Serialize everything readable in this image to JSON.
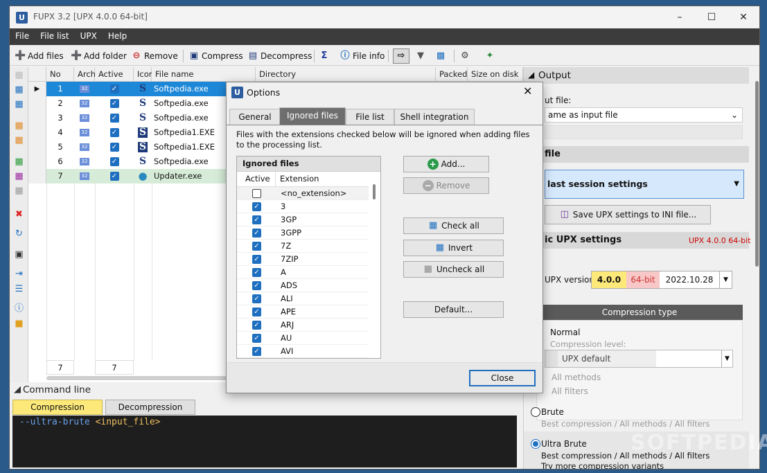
{
  "window": {
    "title": "FUPX 3.2   [UPX 4.0.0 64-bit]",
    "app_icon": "U"
  },
  "menu": [
    "File",
    "File list",
    "UPX",
    "Help"
  ],
  "toolbar": {
    "add_files": "Add files",
    "add_folder": "Add folder",
    "remove": "Remove",
    "compress": "Compress",
    "decompress": "Decompress",
    "file_info": "File info"
  },
  "grid": {
    "columns": [
      "No",
      "Arch.",
      "Active",
      "Icon",
      "File name",
      "Directory",
      "Packed",
      "Size on disk"
    ],
    "rows": [
      {
        "no": "1",
        "arch": "32",
        "name": "Softpedia.exe",
        "icon": "s"
      },
      {
        "no": "2",
        "arch": "32",
        "name": "Softpedia.exe",
        "icon": "s"
      },
      {
        "no": "3",
        "arch": "32",
        "name": "Softpedia.exe",
        "icon": "s"
      },
      {
        "no": "4",
        "arch": "32",
        "name": "Softpedia1.EXE",
        "icon": "box"
      },
      {
        "no": "5",
        "arch": "32",
        "name": "Softpedia1.EXE",
        "icon": "box"
      },
      {
        "no": "6",
        "arch": "32",
        "name": "Softpedia.exe",
        "icon": "s"
      },
      {
        "no": "7",
        "arch": "32",
        "name": "Updater.exe",
        "icon": "globe"
      }
    ],
    "footer_count": "7",
    "footer_active": "7"
  },
  "command_line": {
    "title": "Command line",
    "tab_compression": "Compression",
    "tab_decompression": "Decompression",
    "arg_prefix": "--",
    "arg": "ultra-brute",
    "input_token": "<input_file>"
  },
  "output": {
    "title": "Output",
    "output_file_label": "ut file:",
    "output_file_value": "ame as input file",
    "file_section": "file",
    "session_value": "last  session  settings",
    "save_ini": "Save UPX settings to INI file...",
    "upx_settings": "ic UPX settings",
    "upx_version_badge": "UPX 4.0.0 64-bit",
    "upx_version_label": "UPX version:",
    "ver_num": "4.0.0",
    "ver_bits": "64-bit",
    "ver_date": "2022.10.28",
    "compression_type": "Compression type",
    "normal": "Normal",
    "compression_level": "Compression level:",
    "upx_default": "UPX default",
    "all_methods": "All methods",
    "all_filters": "All filters",
    "brute": "Brute",
    "brute_desc": "Best compression / All methods / All filters",
    "ultra_brute": "Ultra Brute",
    "ultra_desc1": "Best compression / All methods / All filters",
    "ultra_desc2": "Try more compression variants"
  },
  "dialog": {
    "title": "Options",
    "tabs": [
      "General",
      "Ignored files",
      "File list",
      "Shell integration"
    ],
    "description": "Files with the extensions checked below will be ignored when adding files",
    "description2": "to the processing list.",
    "list_title": "Ignored files",
    "col_active": "Active",
    "col_extension": "Extension",
    "extensions": [
      {
        "ext": "<no_extension>",
        "checked": false
      },
      {
        "ext": "3",
        "checked": true
      },
      {
        "ext": "3GP",
        "checked": true
      },
      {
        "ext": "3GPP",
        "checked": true
      },
      {
        "ext": "7Z",
        "checked": true
      },
      {
        "ext": "7ZIP",
        "checked": true
      },
      {
        "ext": "A",
        "checked": true
      },
      {
        "ext": "ADS",
        "checked": true
      },
      {
        "ext": "ALI",
        "checked": true
      },
      {
        "ext": "APE",
        "checked": true
      },
      {
        "ext": "ARJ",
        "checked": true
      },
      {
        "ext": "AU",
        "checked": true
      },
      {
        "ext": "AVI",
        "checked": true
      }
    ],
    "add": "Add...",
    "remove": "Remove",
    "check_all": "Check all",
    "invert": "Invert",
    "uncheck_all": "Uncheck all",
    "default": "Default...",
    "close": "Close"
  },
  "watermark": "SOFTPEDIA",
  "colors": {
    "selection": "#1e88d8",
    "highlight_row": "#d6ecd8",
    "accent": "#1f6fc0",
    "menubar": "#3c3c3c"
  }
}
